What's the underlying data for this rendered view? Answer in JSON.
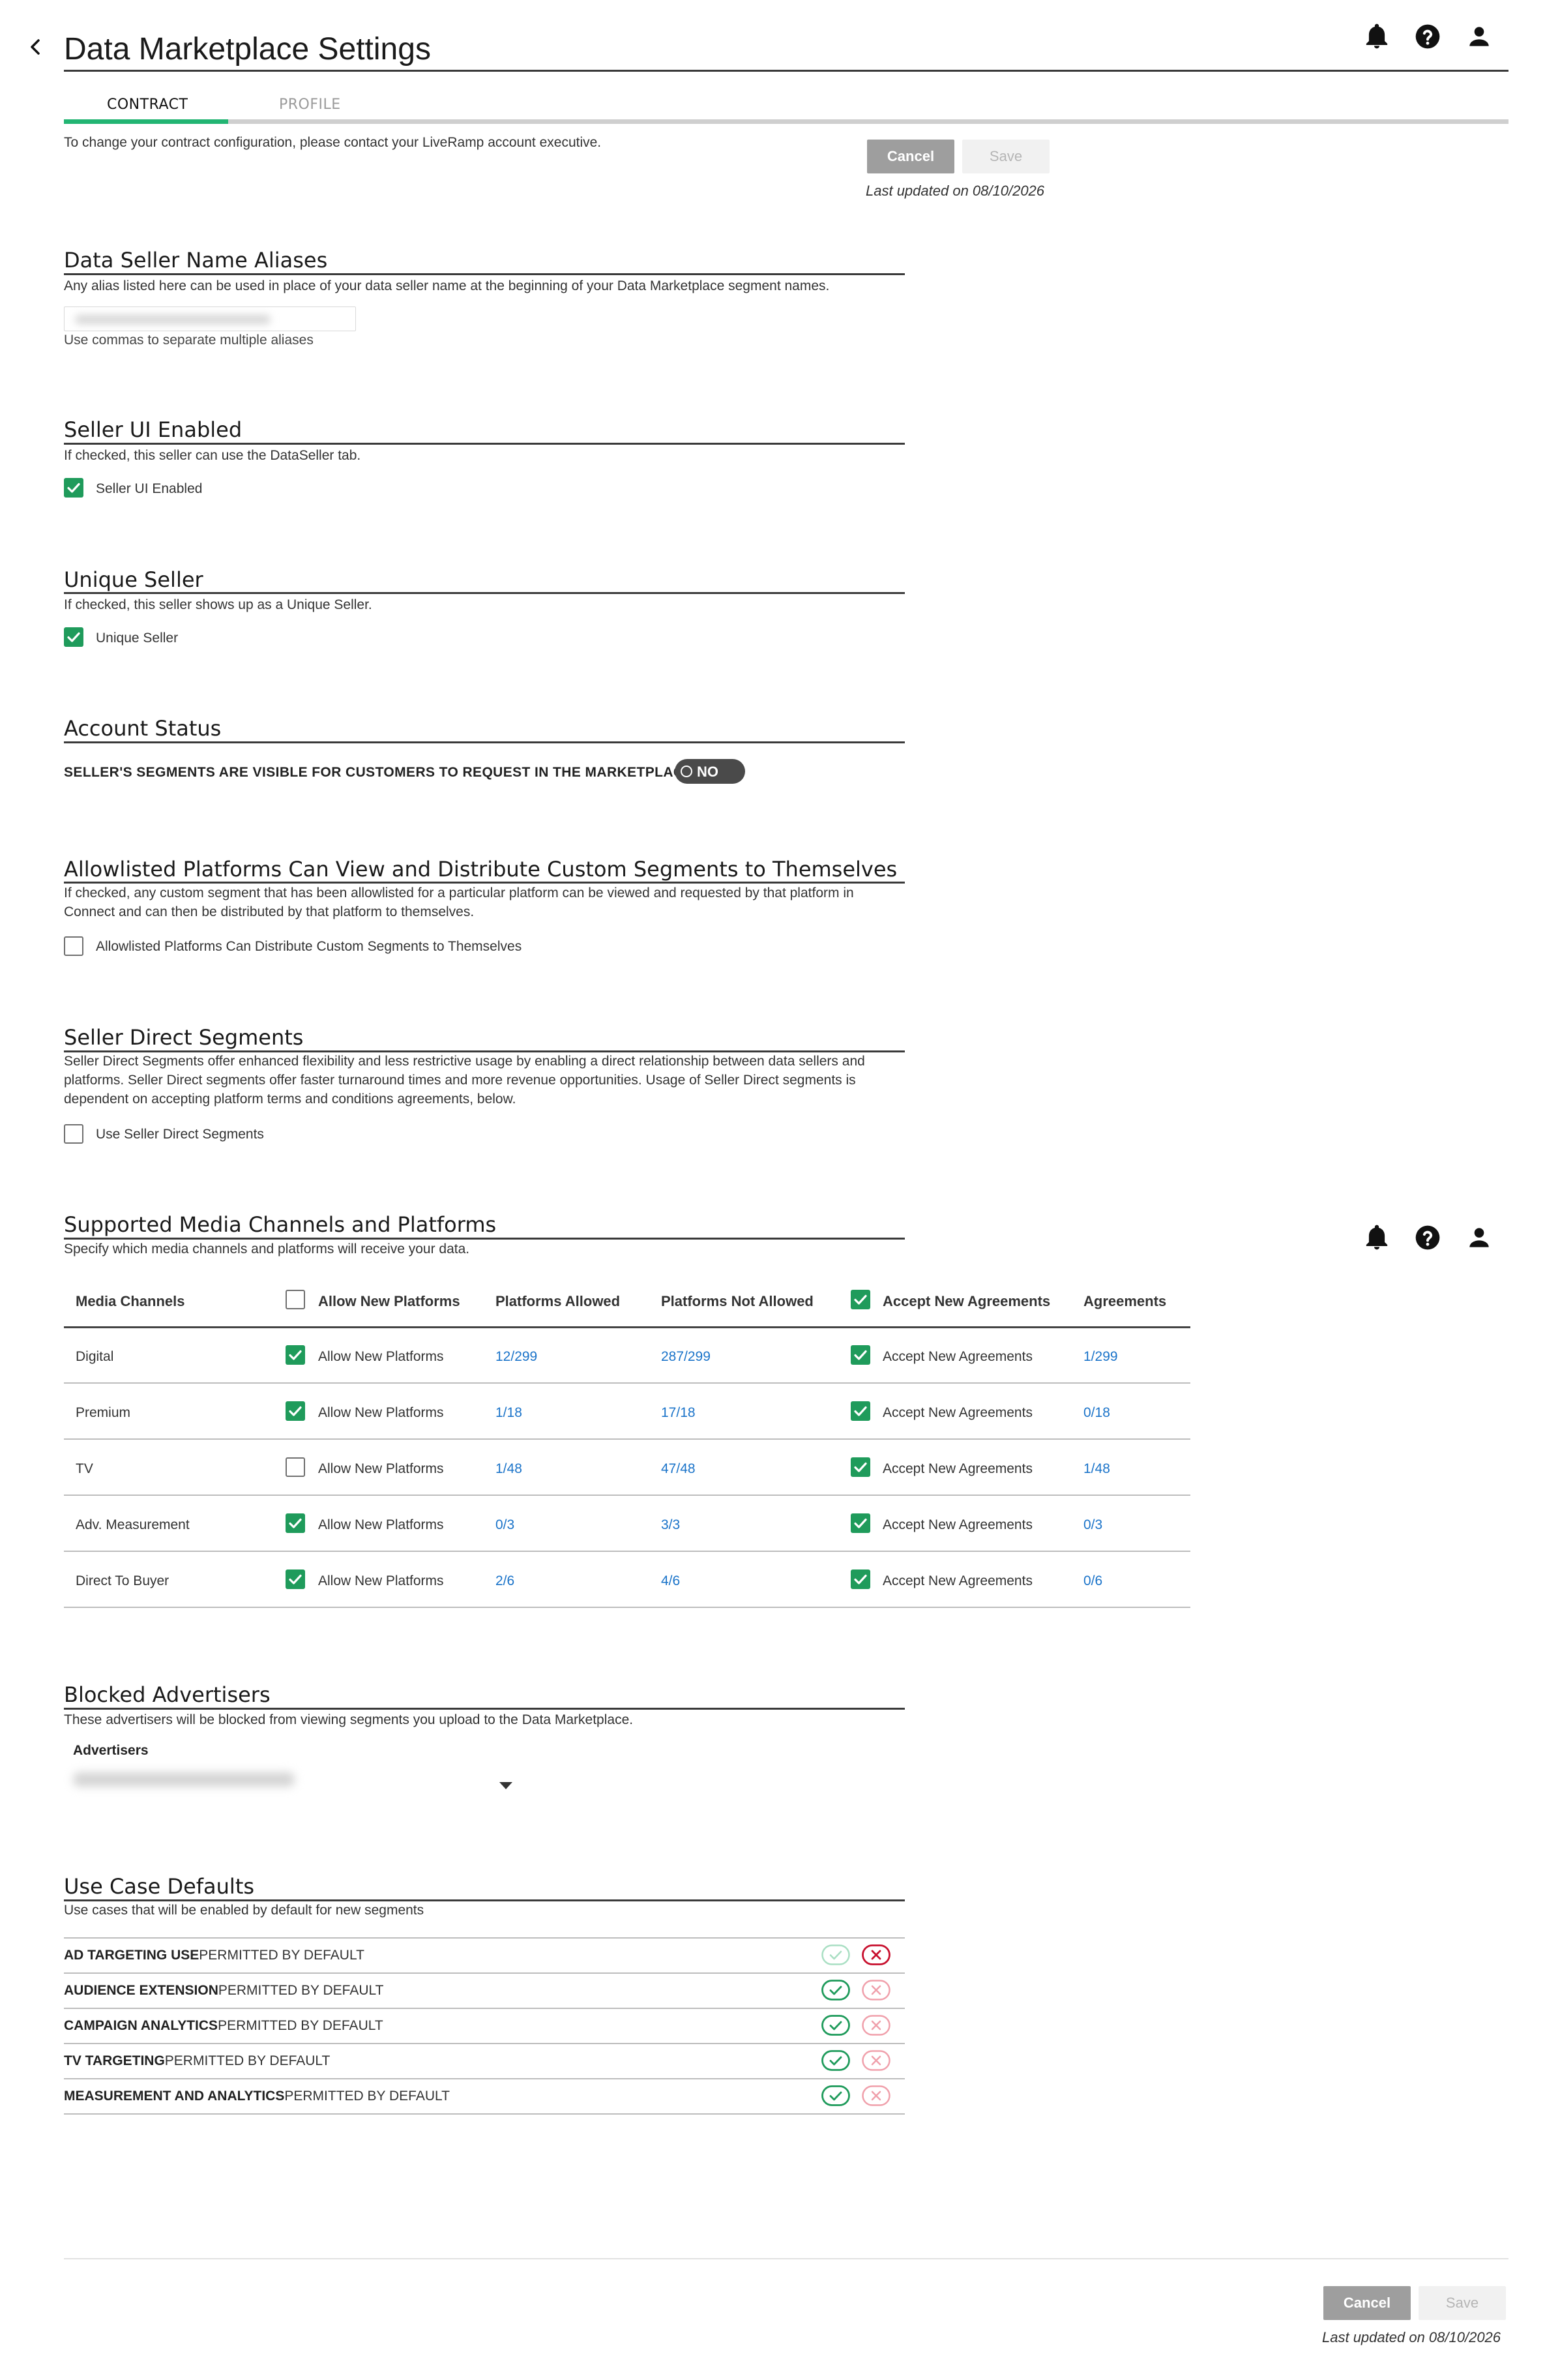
{
  "header": {
    "title": "Data Marketplace Settings"
  },
  "tabs": [
    {
      "label": "CONTRACT",
      "active": true
    },
    {
      "label": "PROFILE",
      "active": false
    }
  ],
  "intro": "To change your contract configuration, please contact your LiveRamp account executive.",
  "actions": {
    "cancel": "Cancel",
    "save": "Save",
    "last_updated": "Last updated on 08/10/2026"
  },
  "aliases": {
    "title": "Data Seller Name Aliases",
    "description": "Any alias listed here can be used in place of your data seller name at the beginning of your Data Marketplace segment names.",
    "hint": "Use commas to separate multiple aliases"
  },
  "seller_ui": {
    "title": "Seller UI Enabled",
    "description": "If checked, this seller can use the DataSeller tab.",
    "checkbox_label": "Seller UI Enabled",
    "checked": true
  },
  "unique_seller": {
    "title": "Unique Seller",
    "description": "If checked, this seller shows up as a Unique Seller.",
    "checkbox_label": "Unique Seller",
    "checked": true
  },
  "account_status": {
    "title": "Account Status",
    "label": "SELLER'S SEGMENTS ARE VISIBLE FOR CUSTOMERS TO REQUEST IN THE MARKETPLACE",
    "toggle": "NO"
  },
  "allowlisted": {
    "title": "Allowlisted Platforms Can View and Distribute Custom Segments to Themselves",
    "description": "If checked, any custom segment that has been allowlisted for a particular platform can be viewed and requested by that platform in Connect and can then be distributed by that platform to themselves.",
    "checkbox_label": "Allowlisted Platforms Can Distribute Custom Segments to Themselves",
    "checked": false
  },
  "seller_direct": {
    "title": "Seller Direct Segments",
    "description": "Seller Direct Segments offer enhanced flexibility and less restrictive usage by enabling a direct relationship between data sellers and platforms. Seller Direct segments offer faster turnaround times and more revenue opportunities. Usage of Seller Direct segments is dependent on accepting platform terms and conditions agreements, below.",
    "checkbox_label": "Use Seller Direct Segments",
    "checked": false
  },
  "media": {
    "title": "Supported Media Channels and Platforms",
    "description": "Specify which media channels and platforms will receive your data.",
    "columns": {
      "channel": "Media Channels",
      "allow_new": "Allow New Platforms",
      "allowed": "Platforms Allowed",
      "not_allowed": "Platforms Not Allowed",
      "accept_new": "Accept New Agreements",
      "agreements": "Agreements"
    },
    "header_allow_checked": false,
    "header_accept_checked": true,
    "rows": [
      {
        "channel": "Digital",
        "allow_checked": true,
        "allow_label": "Allow New Platforms",
        "allowed": "12/299",
        "not_allowed": "287/299",
        "accept_checked": true,
        "accept_label": "Accept New Agreements",
        "agreements": "1/299"
      },
      {
        "channel": "Premium",
        "allow_checked": true,
        "allow_label": "Allow New Platforms",
        "allowed": "1/18",
        "not_allowed": "17/18",
        "accept_checked": true,
        "accept_label": "Accept New Agreements",
        "agreements": "0/18"
      },
      {
        "channel": "TV",
        "allow_checked": false,
        "allow_label": "Allow New Platforms",
        "allowed": "1/48",
        "not_allowed": "47/48",
        "accept_checked": true,
        "accept_label": "Accept New Agreements",
        "agreements": "1/48"
      },
      {
        "channel": "Adv. Measurement",
        "allow_checked": true,
        "allow_label": "Allow New Platforms",
        "allowed": "0/3",
        "not_allowed": "3/3",
        "accept_checked": true,
        "accept_label": "Accept New Agreements",
        "agreements": "0/3"
      },
      {
        "channel": "Direct To Buyer",
        "allow_checked": true,
        "allow_label": "Allow New Platforms",
        "allowed": "2/6",
        "not_allowed": "4/6",
        "accept_checked": true,
        "accept_label": "Accept New Agreements",
        "agreements": "0/6"
      }
    ]
  },
  "blocked": {
    "title": "Blocked Advertisers",
    "description": "These advertisers will be blocked from viewing segments you upload to the Data Marketplace.",
    "field_label": "Advertisers"
  },
  "use_cases": {
    "title": "Use Case Defaults",
    "description": "Use cases that will be enabled by default for new segments",
    "items": [
      {
        "name": "AD TARGETING USE",
        "suffix": "PERMITTED BY DEFAULT",
        "selected": "deny"
      },
      {
        "name": "AUDIENCE EXTENSION",
        "suffix": "PERMITTED BY DEFAULT",
        "selected": "allow"
      },
      {
        "name": "CAMPAIGN ANALYTICS",
        "suffix": "PERMITTED BY DEFAULT",
        "selected": "allow"
      },
      {
        "name": "TV TARGETING",
        "suffix": "PERMITTED BY DEFAULT",
        "selected": "allow"
      },
      {
        "name": "MEASUREMENT AND ANALYTICS",
        "suffix": "PERMITTED BY DEFAULT",
        "selected": "allow"
      }
    ]
  },
  "colors": {
    "accent_green": "#22b573",
    "checkbox_green": "#1f9b5b",
    "link_blue": "#1a73c9",
    "deny_red": "#c8102e"
  },
  "icons": [
    "back-chevron-icon",
    "bell-icon",
    "help-icon",
    "user-icon",
    "check-icon",
    "x-icon"
  ]
}
